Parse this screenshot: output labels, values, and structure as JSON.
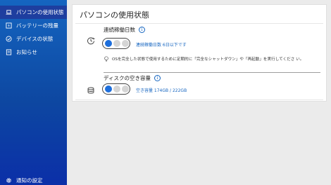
{
  "sidebar": {
    "items": [
      {
        "label": "パソコンの使用状態",
        "icon": "laptop-icon",
        "active": true
      },
      {
        "label": "バッテリーの残量",
        "icon": "battery-icon",
        "active": false
      },
      {
        "label": "デバイスの状態",
        "icon": "device-status-icon",
        "active": false
      },
      {
        "label": "お知らせ",
        "icon": "notice-icon",
        "active": false
      }
    ],
    "bottom_item": {
      "label": "通知の設定",
      "icon": "gear-icon"
    }
  },
  "main": {
    "title": "パソコンの使用状態",
    "sections": [
      {
        "title": "連続稼働日数",
        "icon": "clock-icon",
        "info_icon": "info-icon",
        "level_filled": 1,
        "level_total": 3,
        "value": "連続稼働日数 6日以下です",
        "hint": "OSを完全した状態で使用するために定期的に「完全なシャットダウン」や「再起動」を実行してくださ い。",
        "hint_icon": "lightbulb-icon"
      },
      {
        "title": "ディスクの空き容量",
        "icon": "disk-icon",
        "info_icon": "info-icon",
        "level_filled": 1,
        "level_total": 3,
        "value": "空き容量 174GB / 222GB"
      }
    ]
  },
  "colors": {
    "sidebar_top": "#1565c0",
    "sidebar_bottom": "#0b2fa8",
    "accent": "#1e6fdc",
    "link_text": "#1565c0"
  }
}
